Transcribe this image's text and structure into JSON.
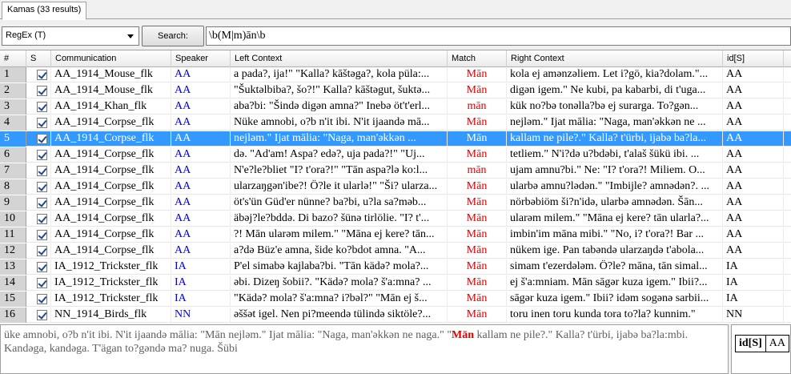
{
  "tab": {
    "label": "Kamas (33 results)"
  },
  "search": {
    "mode": "RegEx (T)",
    "button_label": "Search:",
    "query": "\\b(M|m)ān\\b"
  },
  "columns": [
    "#",
    "S",
    "Communication",
    "Speaker",
    "Left Context",
    "Match",
    "Right Context",
    "id[S]"
  ],
  "rows": [
    {
      "n": "1",
      "comm": "AA_1914_Mouse_flk",
      "spk": "AA",
      "left": "a pada?, ija!\" \"Kalla? kāštəga?, kola püla:...",
      "match": "Mān",
      "right": "kola ej amənzəliem. Let i?gö, kia?dolam.\"...",
      "id": "AA"
    },
    {
      "n": "2",
      "comm": "AA_1914_Mouse_flk",
      "spk": "AA",
      "left": "\"Šuktəlbiba?, šo?!\" Kalla? kāštəgut, šuktə...",
      "match": "Mān",
      "right": "digən igem.\" Ne kubi, pa kabarbi, di t'uga...",
      "id": "AA"
    },
    {
      "n": "3",
      "comm": "AA_1914_Khan_flk",
      "spk": "AA",
      "left": "aba?bi: \"Šində digən amna?\" Inebə öt't'erl...",
      "match": "mān",
      "right": "kük no?bə tonəlla?bə ej surarga. To?gən...",
      "id": "AA"
    },
    {
      "n": "4",
      "comm": "AA_1914_Corpse_flk",
      "spk": "AA",
      "left": "Nüke amnobi, o?b n'it ibi. N'it ijaandə mā...",
      "match": "Mān",
      "right": "nejləm.\" Ijat mālia: \"Naga, man'əkkən ne ...",
      "id": "AA"
    },
    {
      "n": "5",
      "comm": "AA_1914_Corpse_flk",
      "spk": "AA",
      "left": "nejləm.\" Ijat mālia: \"Naga, man'əkkən ...",
      "match": "Mān",
      "right": "kallam ne pile?.\" Kalla? t'ürbi, ijabə ba?la...",
      "id": "AA",
      "selected": true
    },
    {
      "n": "6",
      "comm": "AA_1914_Corpse_flk",
      "spk": "AA",
      "left": "də. \"Ad'am! Aspa? edə?, uja pada?!\" \"Uj...",
      "match": "Mān",
      "right": "tetliem.\" N'i?də u?bdəbi, t'alaš šükü ibi. ...",
      "id": "AA"
    },
    {
      "n": "7",
      "comm": "AA_1914_Corpse_flk",
      "spk": "AA",
      "left": "N'e?le?bliet \"I? t'ora?!\" \"Tān aspa?lə ko:l...",
      "match": "mān",
      "right": "ujam amnu?bi.\" Ne: \"I? t'ora?! Miliem. O...",
      "id": "AA"
    },
    {
      "n": "8",
      "comm": "AA_1914_Corpse_flk",
      "spk": "AA",
      "left": "ularzaŋgən'ibe?! Ö?le it ularlə!\" \"Ši? ularza...",
      "match": "Mān",
      "right": "ularbə amnu?lədən.\" \"Imbijle? amnədən?. ...",
      "id": "AA"
    },
    {
      "n": "9",
      "comm": "AA_1914_Corpse_flk",
      "spk": "AA",
      "left": "öt's'ün Güd'er nünne? ba?bi, u?la sa?məb...",
      "match": "Mān",
      "right": "nörbəbiöm ši?n'idə, ularbə amnədən. Šān...",
      "id": "AA"
    },
    {
      "n": "10",
      "comm": "AA_1914_Corpse_flk",
      "spk": "AA",
      "left": "äbəj?le?bddə. Di bazo? šünə tirlölie. \"I? t'...",
      "match": "Mān",
      "right": "ularəm milem.\" \"Māna ej kere? tān ularla?...",
      "id": "AA"
    },
    {
      "n": "11",
      "comm": "AA_1914_Corpse_flk",
      "spk": "AA",
      "left": "?! Mān ularəm milem.\" \"Māna ej kere? tān...",
      "match": "Mān",
      "right": "imbin'im māna mibi.\" \"No, i? t'ora?! Bar ...",
      "id": "AA"
    },
    {
      "n": "12",
      "comm": "AA_1914_Corpse_flk",
      "spk": "AA",
      "left": "a?də Büz'e amna, šide ko?bdot amna. \"A...",
      "match": "Mān",
      "right": "nükem ige. Pan tabəndə ularzaŋdə t'abola...",
      "id": "AA"
    },
    {
      "n": "13",
      "comm": "IA_1912_Trickster_flk",
      "spk": "IA",
      "left": "P'el simabə kajlaba?bi. \"Tān kädə? mola?...",
      "match": "Mān",
      "right": "simam t'ezerdələm. Ö?le? māna, tān simal...",
      "id": "IA"
    },
    {
      "n": "14",
      "comm": "IA_1912_Trickster_flk",
      "spk": "IA",
      "left": "əbi. Dizeŋ šobii?. \"Kädə? mola? š'a:mna? ...",
      "match": "Mān",
      "right": "ej š'a:mniam. Mān sāgər kuza igem.\" Ibii?...",
      "id": "IA"
    },
    {
      "n": "15",
      "comm": "IA_1912_Trickster_flk",
      "spk": "IA",
      "left": "\"Kädə? mola? š'a:mna? i?bəl?\" \"Mān ej š...",
      "match": "Mān",
      "right": "sāgər kuza igem.\" Ibii? idəm sogənə sarbii...",
      "id": "IA"
    },
    {
      "n": "16",
      "comm": "NN_1914_Birds_flk",
      "spk": "NN",
      "left": "əššət igel. Nen pi?meendə tülində siktöle?...",
      "match": "Mān",
      "right": "toru inen toru kunda tora to?la? kunnim.\"",
      "id": "NN"
    }
  ],
  "preview": {
    "left": "üke amnobi, o?b n'it ibi. N'it ijaandə mālia: \"Mān nejləm.\" Ijat mālia: \"Naga, man'əkkən ne naga.\" \"",
    "match": "Mān",
    "right": " kallam ne pile?.\" Kalla? t'ürbi, ijabə ba?la:mbi. Kandəga, kandəga. T'ägan to?gəndə ma? nuga. Šübi"
  },
  "meta": {
    "key": "id[S]",
    "value": "AA"
  }
}
